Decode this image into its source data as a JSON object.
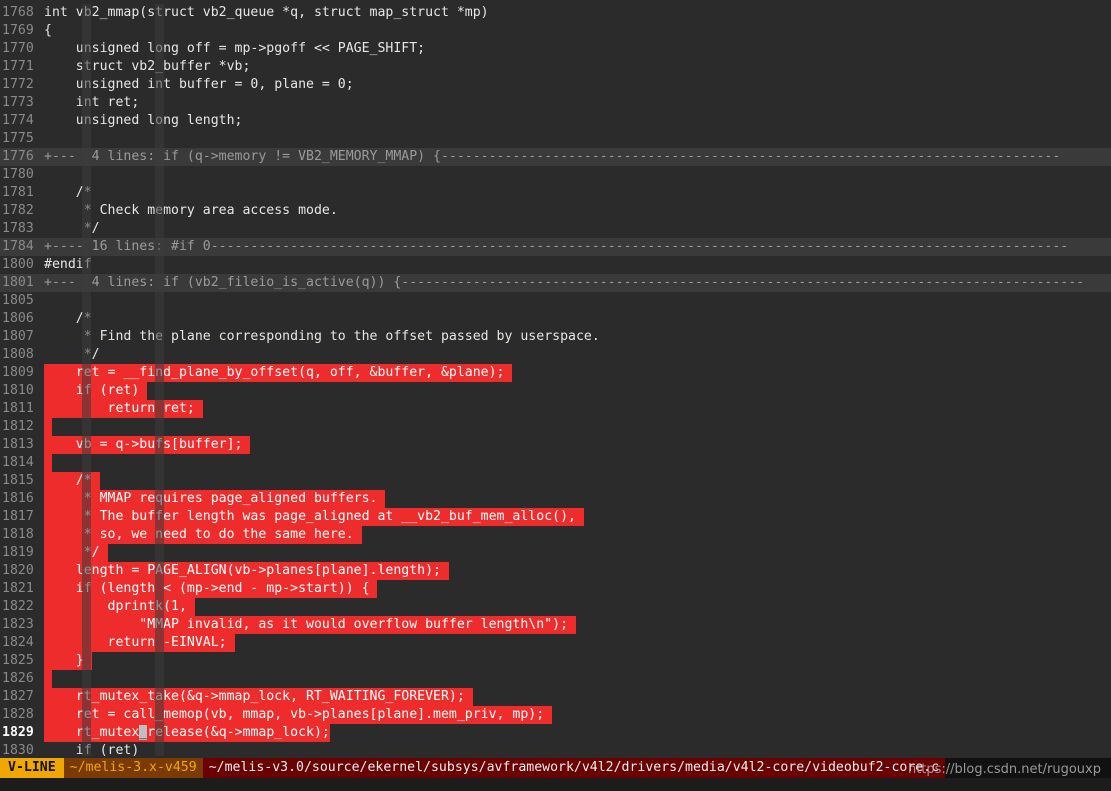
{
  "editor": {
    "lines": [
      {
        "n": "1768",
        "t": "int vb2_mmap(struct vb2_queue *q, struct map_struct *mp)"
      },
      {
        "n": "1769",
        "t": "{"
      },
      {
        "n": "1770",
        "t": "    unsigned long off = mp->pgoff << PAGE_SHIFT;"
      },
      {
        "n": "1771",
        "t": "    struct vb2_buffer *vb;"
      },
      {
        "n": "1772",
        "t": "    unsigned int buffer = 0, plane = 0;"
      },
      {
        "n": "1773",
        "t": "    int ret;"
      },
      {
        "n": "1774",
        "t": "    unsigned long length;"
      },
      {
        "n": "1775",
        "t": ""
      },
      {
        "n": "1776",
        "t": "+---  4 lines: if (q->memory != VB2_MEMORY_MMAP) {------------------------------------------------------------------------------",
        "fold": true
      },
      {
        "n": "1780",
        "t": ""
      },
      {
        "n": "1781",
        "t": "    /*"
      },
      {
        "n": "1782",
        "t": "     * Check memory area access mode."
      },
      {
        "n": "1783",
        "t": "     */"
      },
      {
        "n": "1784",
        "t": "+---- 16 lines: #if 0------------------------------------------------------------------------------------------------------------",
        "fold": true
      },
      {
        "n": "1800",
        "t": "#endif"
      },
      {
        "n": "1801",
        "t": "+---  4 lines: if (vb2_fileio_is_active(q)) {--------------------------------------------------------------------------------------",
        "fold": true
      },
      {
        "n": "1805",
        "t": ""
      },
      {
        "n": "1806",
        "t": "    /*"
      },
      {
        "n": "1807",
        "t": "     * Find the plane corresponding to the offset passed by userspace."
      },
      {
        "n": "1808",
        "t": "     */"
      },
      {
        "n": "1809",
        "t": "    ret = __find_plane_by_offset(q, off, &buffer, &plane); ",
        "sel": true
      },
      {
        "n": "1810",
        "t": "    if (ret) ",
        "sel": true
      },
      {
        "n": "1811",
        "t": "        return ret; ",
        "sel": true
      },
      {
        "n": "1812",
        "t": " ",
        "sel": true
      },
      {
        "n": "1813",
        "t": "    vb = q->bufs[buffer]; ",
        "sel": true
      },
      {
        "n": "1814",
        "t": " ",
        "sel": true
      },
      {
        "n": "1815",
        "t": "    /* ",
        "sel": true
      },
      {
        "n": "1816",
        "t": "     * MMAP requires page_aligned buffers. ",
        "sel": true
      },
      {
        "n": "1817",
        "t": "     * The buffer length was page_aligned at __vb2_buf_mem_alloc(), ",
        "sel": true
      },
      {
        "n": "1818",
        "t": "     * so, we need to do the same here. ",
        "sel": true
      },
      {
        "n": "1819",
        "t": "     */ ",
        "sel": true
      },
      {
        "n": "1820",
        "t": "    length = PAGE_ALIGN(vb->planes[plane].length); ",
        "sel": true
      },
      {
        "n": "1821",
        "t": "    if (length < (mp->end - mp->start)) { ",
        "sel": true
      },
      {
        "n": "1822",
        "t": "        dprintk(1, ",
        "sel": true
      },
      {
        "n": "1823",
        "t": "            \"MMAP invalid, as it would overflow buffer length\\n\"); ",
        "sel": true
      },
      {
        "n": "1824",
        "t": "        return -EINVAL; ",
        "sel": true
      },
      {
        "n": "1825",
        "t": "    } ",
        "sel": true
      },
      {
        "n": "1826",
        "t": " ",
        "sel": true
      },
      {
        "n": "1827",
        "t": "    rt_mutex_take(&q->mmap_lock, RT_WAITING_FOREVER); ",
        "sel": true
      },
      {
        "n": "1828",
        "t": "    ret = call_memop(vb, mmap, vb->planes[plane].mem_priv, mp); ",
        "sel": true
      },
      {
        "n": "1829",
        "t": "    rt_mutex_release(&q->mmap_lock);",
        "sel": true,
        "cur": true
      },
      {
        "n": "1830",
        "t": "    if (ret)"
      }
    ]
  },
  "status": {
    "mode": "V-LINE",
    "branch": "~/melis-3.x-v459",
    "path": "~/melis-v3.0/source/ekernel/subsys/avframework/v4l2/drivers/media/v4l2-core/videobuf2-core.c"
  },
  "watermark": "https://blog.csdn.net/rugouxp"
}
